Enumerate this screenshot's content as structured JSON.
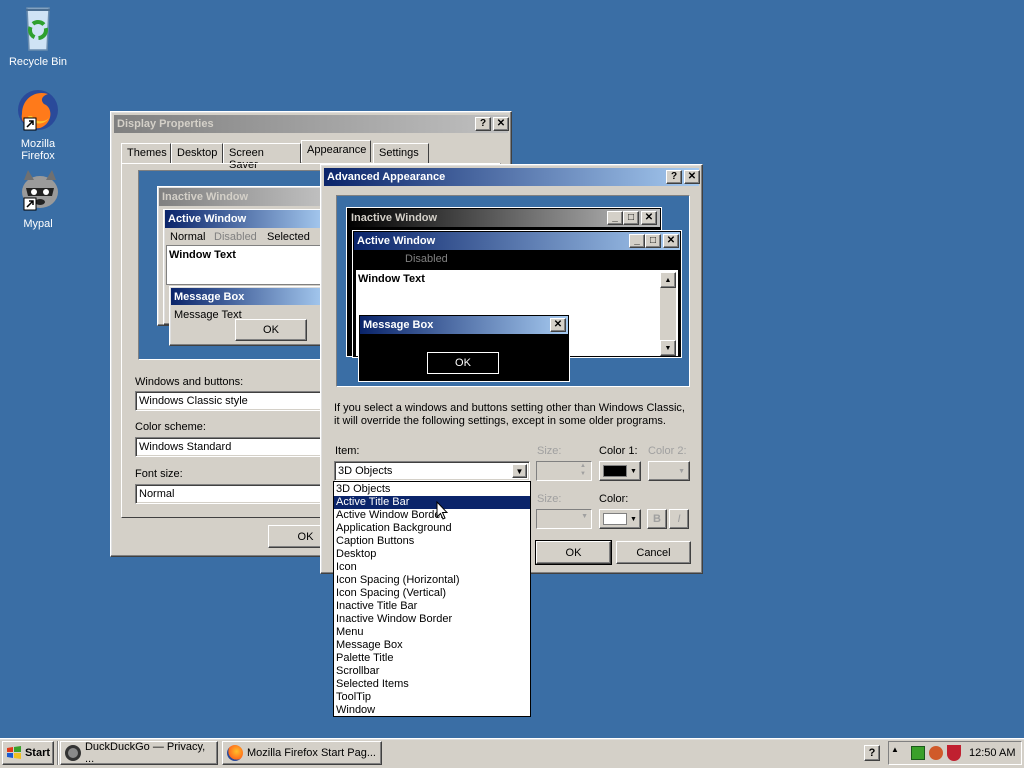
{
  "desktop": {
    "icons": [
      {
        "label": "Recycle Bin"
      },
      {
        "label": "Mozilla Firefox"
      },
      {
        "label": "Mypal"
      }
    ]
  },
  "display_properties": {
    "title": "Display Properties",
    "tabs": [
      "Themes",
      "Desktop",
      "Screen Saver",
      "Appearance",
      "Settings"
    ],
    "selected_tab": "Appearance",
    "preview": {
      "inactive_title": "Inactive Window",
      "active_title": "Active Window",
      "menu_normal": "Normal",
      "menu_disabled": "Disabled",
      "menu_selected": "Selected",
      "window_text": "Window Text",
      "message_box_title": "Message Box",
      "message_text": "Message Text",
      "ok": "OK"
    },
    "windows_buttons_label": "Windows and buttons:",
    "windows_buttons_value": "Windows Classic style",
    "color_scheme_label": "Color scheme:",
    "color_scheme_value": "Windows Standard",
    "font_size_label": "Font size:",
    "font_size_value": "Normal",
    "ok": "OK"
  },
  "advanced": {
    "title": "Advanced Appearance",
    "preview": {
      "inactive_title": "Inactive Window",
      "active_title": "Active Window",
      "menu_disabled": "Disabled",
      "window_text": "Window Text",
      "message_box_title": "Message Box",
      "ok": "OK"
    },
    "info_line1": "If you select a windows and buttons setting other than Windows Classic,",
    "info_line2": "it will override the following settings, except in some older programs.",
    "item_label": "Item:",
    "item_value": "3D Objects",
    "size_label": "Size:",
    "color1_label": "Color 1:",
    "color2_label": "Color 2:",
    "font_size_label": "Size:",
    "font_color_label": "Color:",
    "bold": "B",
    "italic": "I",
    "ok": "OK",
    "cancel": "Cancel",
    "dropdown_items": [
      "3D Objects",
      "Active Title Bar",
      "Active Window Border",
      "Application Background",
      "Caption Buttons",
      "Desktop",
      "Icon",
      "Icon Spacing (Horizontal)",
      "Icon Spacing (Vertical)",
      "Inactive Title Bar",
      "Inactive Window Border",
      "Menu",
      "Message Box",
      "Palette Title",
      "Scrollbar",
      "Selected Items",
      "ToolTip",
      "Window"
    ],
    "dropdown_selected": "Active Title Bar"
  },
  "taskbar": {
    "start": "Start",
    "tasks": [
      "DuckDuckGo — Privacy, ...",
      "Mozilla Firefox Start Pag..."
    ],
    "clock": "12:50 AM"
  },
  "colors": {
    "desktop": "#3a6ea5",
    "active_title": "#0a246a",
    "face": "#d4d0c8"
  }
}
